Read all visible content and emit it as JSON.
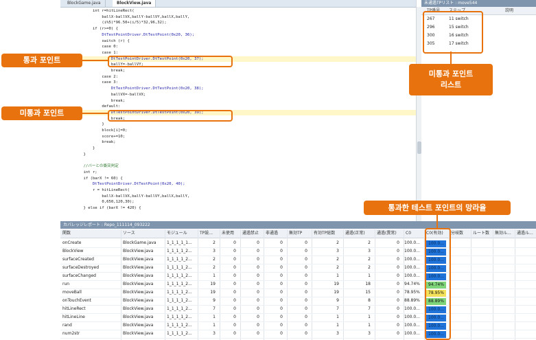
{
  "editor": {
    "tabs": [
      "BlockGame.java",
      "BlockView.java"
    ],
    "lines": [
      "        int r=hitLineRect(",
      "            ballX-ballVX,ballY-ballVY,ballX,ballY,",
      "            (i%5)*96.50+(i/5)*32,96,32);",
      "        if (r>=0) {",
      "            DtTestPointDriver.DtTestPoint(0x20, 36);",
      "            switch (r) {",
      "            case 0:",
      "            case 1:",
      "                DtTestPointDriver.DtTestPoint(0x20, 37);",
      "                ballY=-ballVY;",
      "                break;",
      "            case 2:",
      "            case 3:",
      "                DtTestPointDriver.DtTestPoint(0x20, 38);",
      "                ballVX=-ballVX;",
      "                break;",
      "            default:",
      "                DtTestPointDriver.DtTestPoint(0x20, 39);",
      "                break;",
      "            }",
      "            block[i]=0;",
      "            score+=10;",
      "            break;",
      "        }",
      "    }",
      "",
      "    //バーとの衝突判定",
      "    int r;",
      "    if (barX != 60) {",
      "        DtTestPointDriver.DtTestPoint(0x20, 40);",
      "        r = hitLineRect(",
      "            ballX-ballVX,ballY-ballVY,ballX,ballY,",
      "            0,650,120,30);",
      "    } else if (barX != 420) {"
    ]
  },
  "right_panel": {
    "title": "未通過TPリスト : move544",
    "columns": [
      "TP番号",
      "ステップ",
      "説明"
    ],
    "rows": [
      {
        "id": "267",
        "step": "11 switch"
      },
      {
        "id": "296",
        "step": "15 switch"
      },
      {
        "id": "300",
        "step": "16 switch"
      },
      {
        "id": "305",
        "step": "17 switch"
      }
    ]
  },
  "coverage": {
    "title": "カバレッジレポート : Repo_111114_093222",
    "columns": [
      "関数",
      "ソース",
      "モジュール",
      "TP設...",
      "未使用",
      "通過禁止",
      "非通過",
      "無効TP",
      "有効TP総数",
      "通過(正常)",
      "通過(異常)",
      "C0",
      "C0(有効)",
      "分岐数",
      "ルート数",
      "無効ル...",
      "通過ル..."
    ],
    "rows": [
      {
        "fn": "onCreate",
        "src": "BlockGame.java",
        "mod": "1_1_1_1_1...",
        "v": [
          "2",
          "0",
          "0",
          "0",
          "0",
          "2",
          "2",
          "0"
        ],
        "c0": "100.0...",
        "c0e": "100.0..."
      },
      {
        "fn": "BlockView",
        "src": "BlockView.java",
        "mod": "1_1_1_1_2...",
        "v": [
          "3",
          "0",
          "0",
          "0",
          "0",
          "3",
          "3",
          "0"
        ],
        "c0": "100.0...",
        "c0e": "100.0..."
      },
      {
        "fn": "surfaceCreated",
        "src": "BlockView.java",
        "mod": "1_1_1_1_2...",
        "v": [
          "2",
          "0",
          "0",
          "0",
          "0",
          "2",
          "2",
          "0"
        ],
        "c0": "100.0...",
        "c0e": "100.0..."
      },
      {
        "fn": "surfaceDestroyed",
        "src": "BlockView.java",
        "mod": "1_1_1_1_2...",
        "v": [
          "2",
          "0",
          "0",
          "0",
          "0",
          "2",
          "2",
          "0"
        ],
        "c0": "100.0...",
        "c0e": "100.0..."
      },
      {
        "fn": "surfaceChanged",
        "src": "BlockView.java",
        "mod": "1_1_1_1_2...",
        "v": [
          "1",
          "0",
          "0",
          "0",
          "0",
          "1",
          "1",
          "0"
        ],
        "c0": "100.0...",
        "c0e": "100.0..."
      },
      {
        "fn": "run",
        "src": "BlockView.java",
        "mod": "1_1_1_1_2...",
        "v": [
          "19",
          "0",
          "0",
          "0",
          "0",
          "19",
          "18",
          "0"
        ],
        "c0": "94.74%",
        "c0e": "94.74%"
      },
      {
        "fn": "moveBall",
        "src": "BlockView.java",
        "mod": "1_1_1_1_2...",
        "v": [
          "19",
          "0",
          "0",
          "0",
          "0",
          "19",
          "15",
          "0"
        ],
        "c0": "78.95%",
        "c0e": "78.95%"
      },
      {
        "fn": "onTouchEvent",
        "src": "BlockView.java",
        "mod": "1_1_1_1_2...",
        "v": [
          "9",
          "0",
          "0",
          "0",
          "0",
          "9",
          "8",
          "0"
        ],
        "c0": "88.89%",
        "c0e": "88.89%"
      },
      {
        "fn": "hitLineRect",
        "src": "BlockView.java",
        "mod": "1_1_1_1_2...",
        "v": [
          "7",
          "0",
          "0",
          "0",
          "0",
          "7",
          "7",
          "0"
        ],
        "c0": "100.0...",
        "c0e": "100.0..."
      },
      {
        "fn": "hitLineLine",
        "src": "BlockView.java",
        "mod": "1_1_1_1_2...",
        "v": [
          "1",
          "0",
          "0",
          "0",
          "0",
          "1",
          "1",
          "0"
        ],
        "c0": "100.0...",
        "c0e": "100.0..."
      },
      {
        "fn": "rand",
        "src": "BlockView.java",
        "mod": "1_1_1_1_2...",
        "v": [
          "1",
          "0",
          "0",
          "0",
          "0",
          "1",
          "1",
          "0"
        ],
        "c0": "100.0...",
        "c0e": "100.0..."
      },
      {
        "fn": "num2str",
        "src": "BlockView.java",
        "mod": "1_1_1_1_2...",
        "v": [
          "3",
          "0",
          "0",
          "0",
          "0",
          "3",
          "3",
          "0"
        ],
        "c0": "100.0...",
        "c0e": "100.0..."
      }
    ],
    "colors": {
      "full": "#1f73d9",
      "high": "#7fd67a",
      "mid": "#f3e25a"
    }
  },
  "callouts": {
    "passed": "통과 포인트",
    "unpassed": "미통과 포인트",
    "unpassed_list": "미통과 포인트\n리스트",
    "coverage_rate": "통과한 테스트 포인트의 망라율"
  },
  "accent": "#e8730e"
}
